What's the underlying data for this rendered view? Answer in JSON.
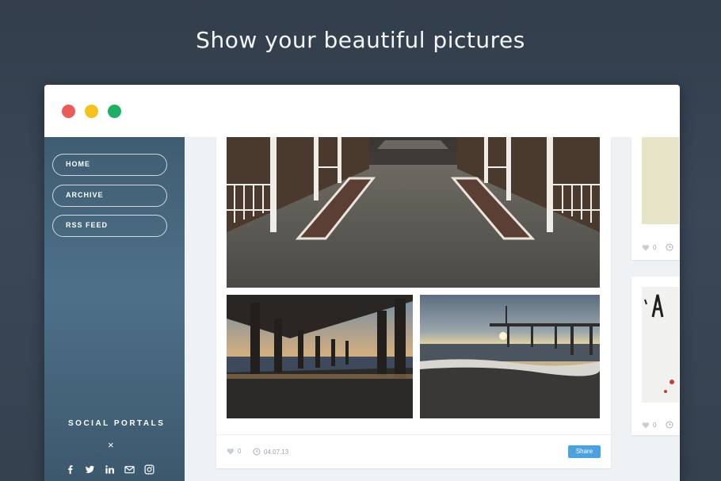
{
  "headline": "Show your beautiful pictures",
  "window": {
    "controls": [
      "close",
      "minimize",
      "maximize"
    ]
  },
  "sidebar": {
    "nav": [
      {
        "label": "HOME"
      },
      {
        "label": "ARCHIVE"
      },
      {
        "label": "RSS FEED"
      }
    ],
    "social_title": "SOCIAL PORTALS",
    "close_glyph": "×",
    "social_icons": [
      "facebook-icon",
      "twitter-icon",
      "linkedin-icon",
      "mail-icon",
      "instagram-icon"
    ]
  },
  "post": {
    "likes": "0",
    "date": "04.07.13",
    "share_label": "Share"
  },
  "side_cards": [
    {
      "likes": "0"
    },
    {
      "likes": "0"
    }
  ],
  "colors": {
    "background": "#333e4c",
    "sidebar": "#4e7089",
    "share": "#4aa3df",
    "dot_red": "#ec5b58",
    "dot_yellow": "#f4c21b",
    "dot_green": "#1db064"
  }
}
